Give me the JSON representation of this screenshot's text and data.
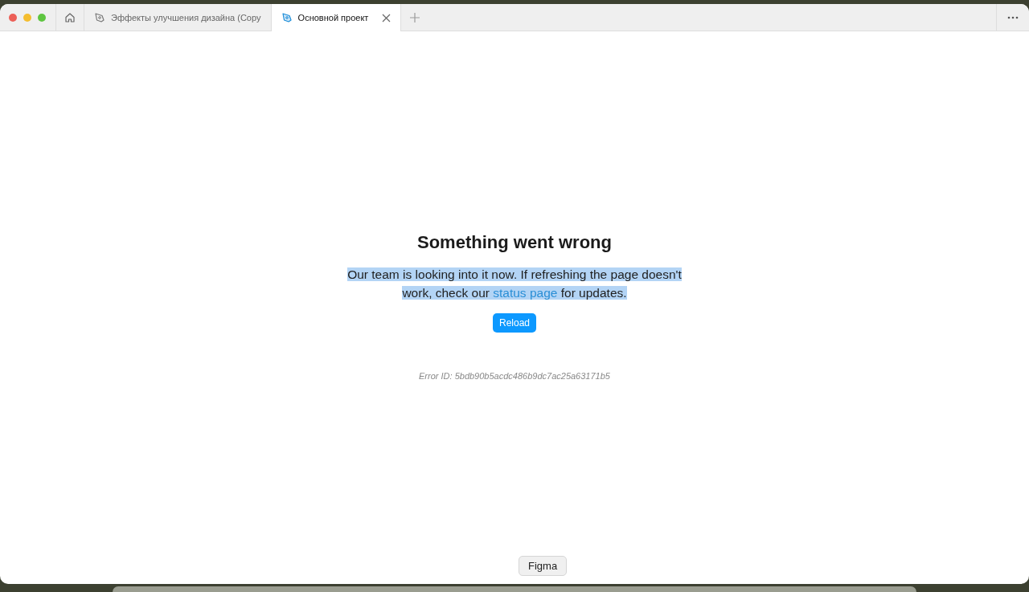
{
  "tabs": [
    {
      "label": "Эффекты улучшения дизайна (Copy",
      "selected": false
    },
    {
      "label": "Основной проект",
      "selected": true
    }
  ],
  "error": {
    "title": "Something went wrong",
    "message_before": "Our team is looking into it now. If refreshing the page doesn't work, check our",
    "link": "status page",
    "message_after": "for updates.",
    "highlighted": true,
    "button": "Reload",
    "error_id": "Error ID: 5bdb90b5acdc486b9dc7ac25a63171b5"
  },
  "dock_tooltip": "Figma"
}
